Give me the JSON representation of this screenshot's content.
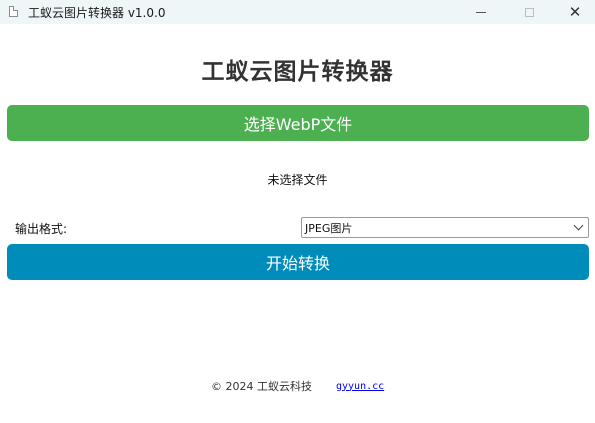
{
  "window": {
    "title": "工蚁云图片转换器 v1.0.0",
    "icon": "document-icon",
    "controls": {
      "minimize": "minimize",
      "maximize": "maximize",
      "close": "✕"
    }
  },
  "header": {
    "title": "工蚁云图片转换器"
  },
  "actions": {
    "select_label": "选择WebP文件",
    "select_color": "#4caf50",
    "start_label": "开始转换",
    "start_color": "#008cba"
  },
  "status": {
    "text": "未选择文件"
  },
  "format": {
    "label": "输出格式:",
    "selected": "JPEG图片"
  },
  "footer": {
    "copyright": "© 2024 工蚁云科技",
    "link": "gyyun.cc"
  }
}
